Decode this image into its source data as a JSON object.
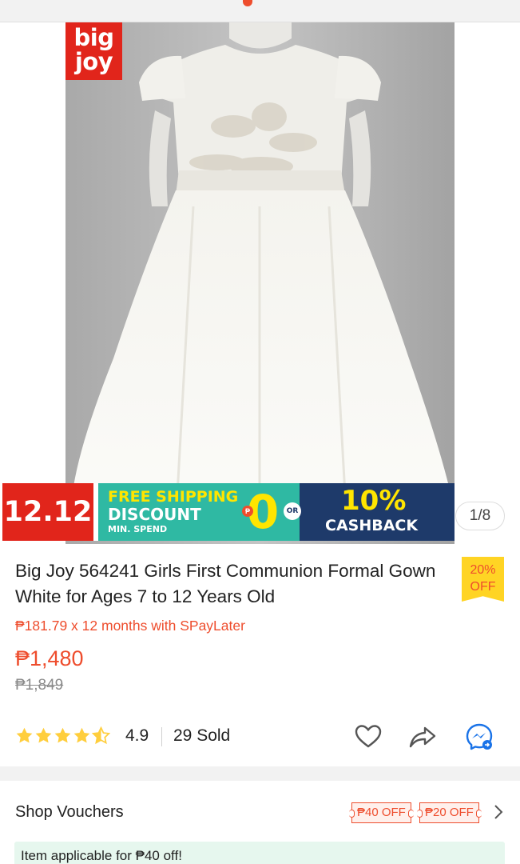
{
  "brand_logo": {
    "line1": "big",
    "line2": "joy"
  },
  "promo_banner": {
    "date": "12.12",
    "free_shipping": "FREE SHIPPING",
    "discount": "DISCOUNT",
    "min_spend": "MIN. SPEND",
    "zero": "0",
    "or": "OR",
    "cashback_percent": "10%",
    "cashback": "CASHBACK"
  },
  "gallery": {
    "counter": "1/8",
    "current": 1,
    "total": 8
  },
  "product": {
    "title": "Big Joy 564241 Girls First Communion Formal Gown White for Ages 7 to 12 Years Old",
    "discount_tag": {
      "percent": "20%",
      "label": "OFF"
    },
    "spaylater": "₱181.79 x 12 months with SPayLater",
    "price": "₱1,480",
    "original_price": "₱1,849",
    "rating": "4.9",
    "rating_value": 4.5,
    "sold": "29 Sold"
  },
  "actions": {
    "icons": [
      "heart-icon",
      "share-icon",
      "messenger-icon"
    ]
  },
  "vouchers": {
    "label": "Shop Vouchers",
    "chips": [
      "₱40 OFF",
      "₱20 OFF"
    ],
    "applicable": "Item applicable for ₱40 off!"
  },
  "colors": {
    "accent": "#ee4d2d",
    "star": "#ffce3d",
    "tag": "#ffd424",
    "teal": "#2fb9a3",
    "navy": "#1e3a6a",
    "red": "#e1251b"
  }
}
